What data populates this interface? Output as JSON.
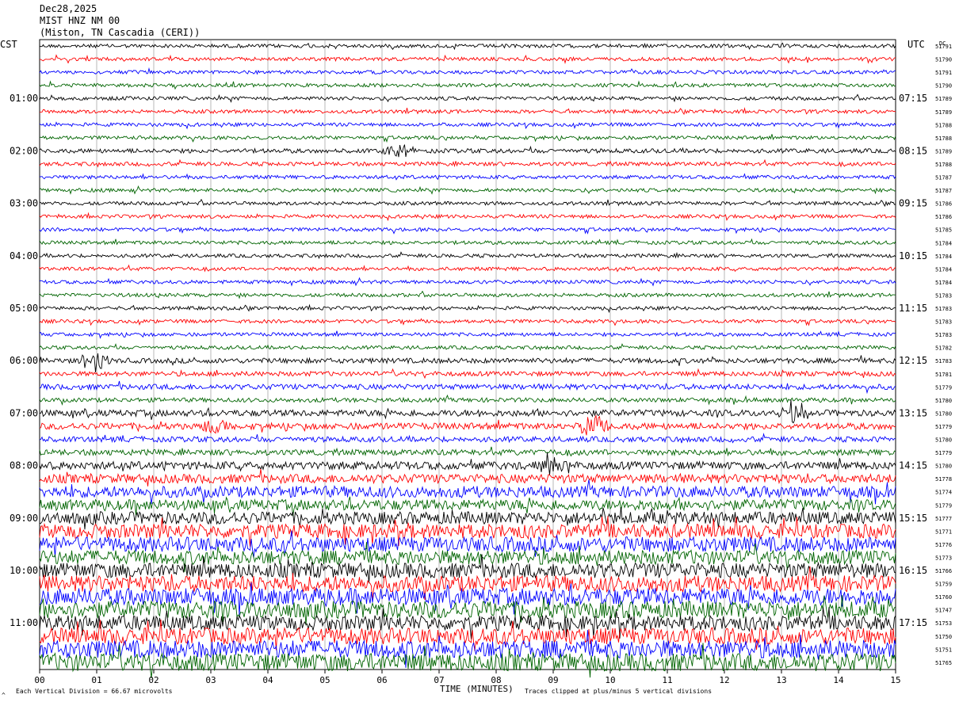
{
  "header": {
    "date": "Dec28,2025",
    "station": "MIST HNZ NM 00",
    "location": "(Miston, TN Cascadia (CERI))"
  },
  "labels": {
    "left_tz": "CST",
    "right_tz": "UTC",
    "dc_header": "DC",
    "xlabel": "TIME (MINUTES)",
    "footer_left": "Each Vertical Division =   66.67 microvolts",
    "footer_right": "Traces clipped at plus/minus 5 vertical divisions",
    "corner_mark": "^"
  },
  "chart_data": {
    "type": "line",
    "title": "MIST HNZ NM 00",
    "xlabel": "TIME (MINUTES)",
    "xlim": [
      0,
      15
    ],
    "x_ticks": [
      "00",
      "01",
      "02",
      "03",
      "04",
      "05",
      "06",
      "07",
      "08",
      "09",
      "10",
      "11",
      "12",
      "13",
      "14",
      "15"
    ],
    "left_time_labels": [
      "01:00",
      "02:00",
      "03:00",
      "04:00",
      "05:00",
      "06:00",
      "07:00",
      "08:00",
      "09:00",
      "10:00",
      "11:00"
    ],
    "right_time_labels": [
      "07:15",
      "08:15",
      "09:15",
      "10:15",
      "11:15",
      "12:15",
      "13:15",
      "14:15",
      "15:15",
      "16:15",
      "17:15"
    ],
    "dc_offsets": [
      51791,
      51790,
      51791,
      51790,
      51789,
      51789,
      51788,
      51788,
      51789,
      51788,
      51787,
      51787,
      51786,
      51786,
      51785,
      51784,
      51784,
      51784,
      51784,
      51783,
      51783,
      51783,
      51783,
      51782,
      51783,
      51781,
      51779,
      51780,
      51780,
      51779,
      51780,
      51779,
      51780,
      51778,
      51774,
      51779,
      51777,
      51771,
      51776,
      51773,
      51766,
      51759,
      51760,
      51747,
      51753,
      51750,
      51751,
      51765
    ],
    "trace_colors": [
      "#000000",
      "#ff0000",
      "#0000ff",
      "#006400"
    ],
    "trace_amplitude": [
      1,
      1,
      1,
      1,
      1,
      1,
      1,
      1,
      1.2,
      1.1,
      1,
      1,
      1,
      1,
      1,
      1,
      1,
      1,
      1,
      1,
      1,
      1,
      1,
      1,
      1.4,
      1.3,
      1.5,
      1.2,
      1.8,
      1.8,
      1.5,
      1.6,
      2.2,
      2.5,
      3.2,
      3.0,
      3.5,
      4.0,
      4.2,
      4.0,
      4.2,
      4.5,
      4.8,
      4.8,
      4.2,
      4.6,
      5.0,
      5.0
    ],
    "events": [
      {
        "trace": 24,
        "minute": 1.0,
        "strength": 4
      },
      {
        "trace": 8,
        "minute": 6.3,
        "strength": 3
      },
      {
        "trace": 29,
        "minute": 9.7,
        "strength": 4
      },
      {
        "trace": 29,
        "minute": 3.0,
        "strength": 3
      },
      {
        "trace": 28,
        "minute": 13.2,
        "strength": 4
      },
      {
        "trace": 32,
        "minute": 9.0,
        "strength": 3
      }
    ]
  }
}
